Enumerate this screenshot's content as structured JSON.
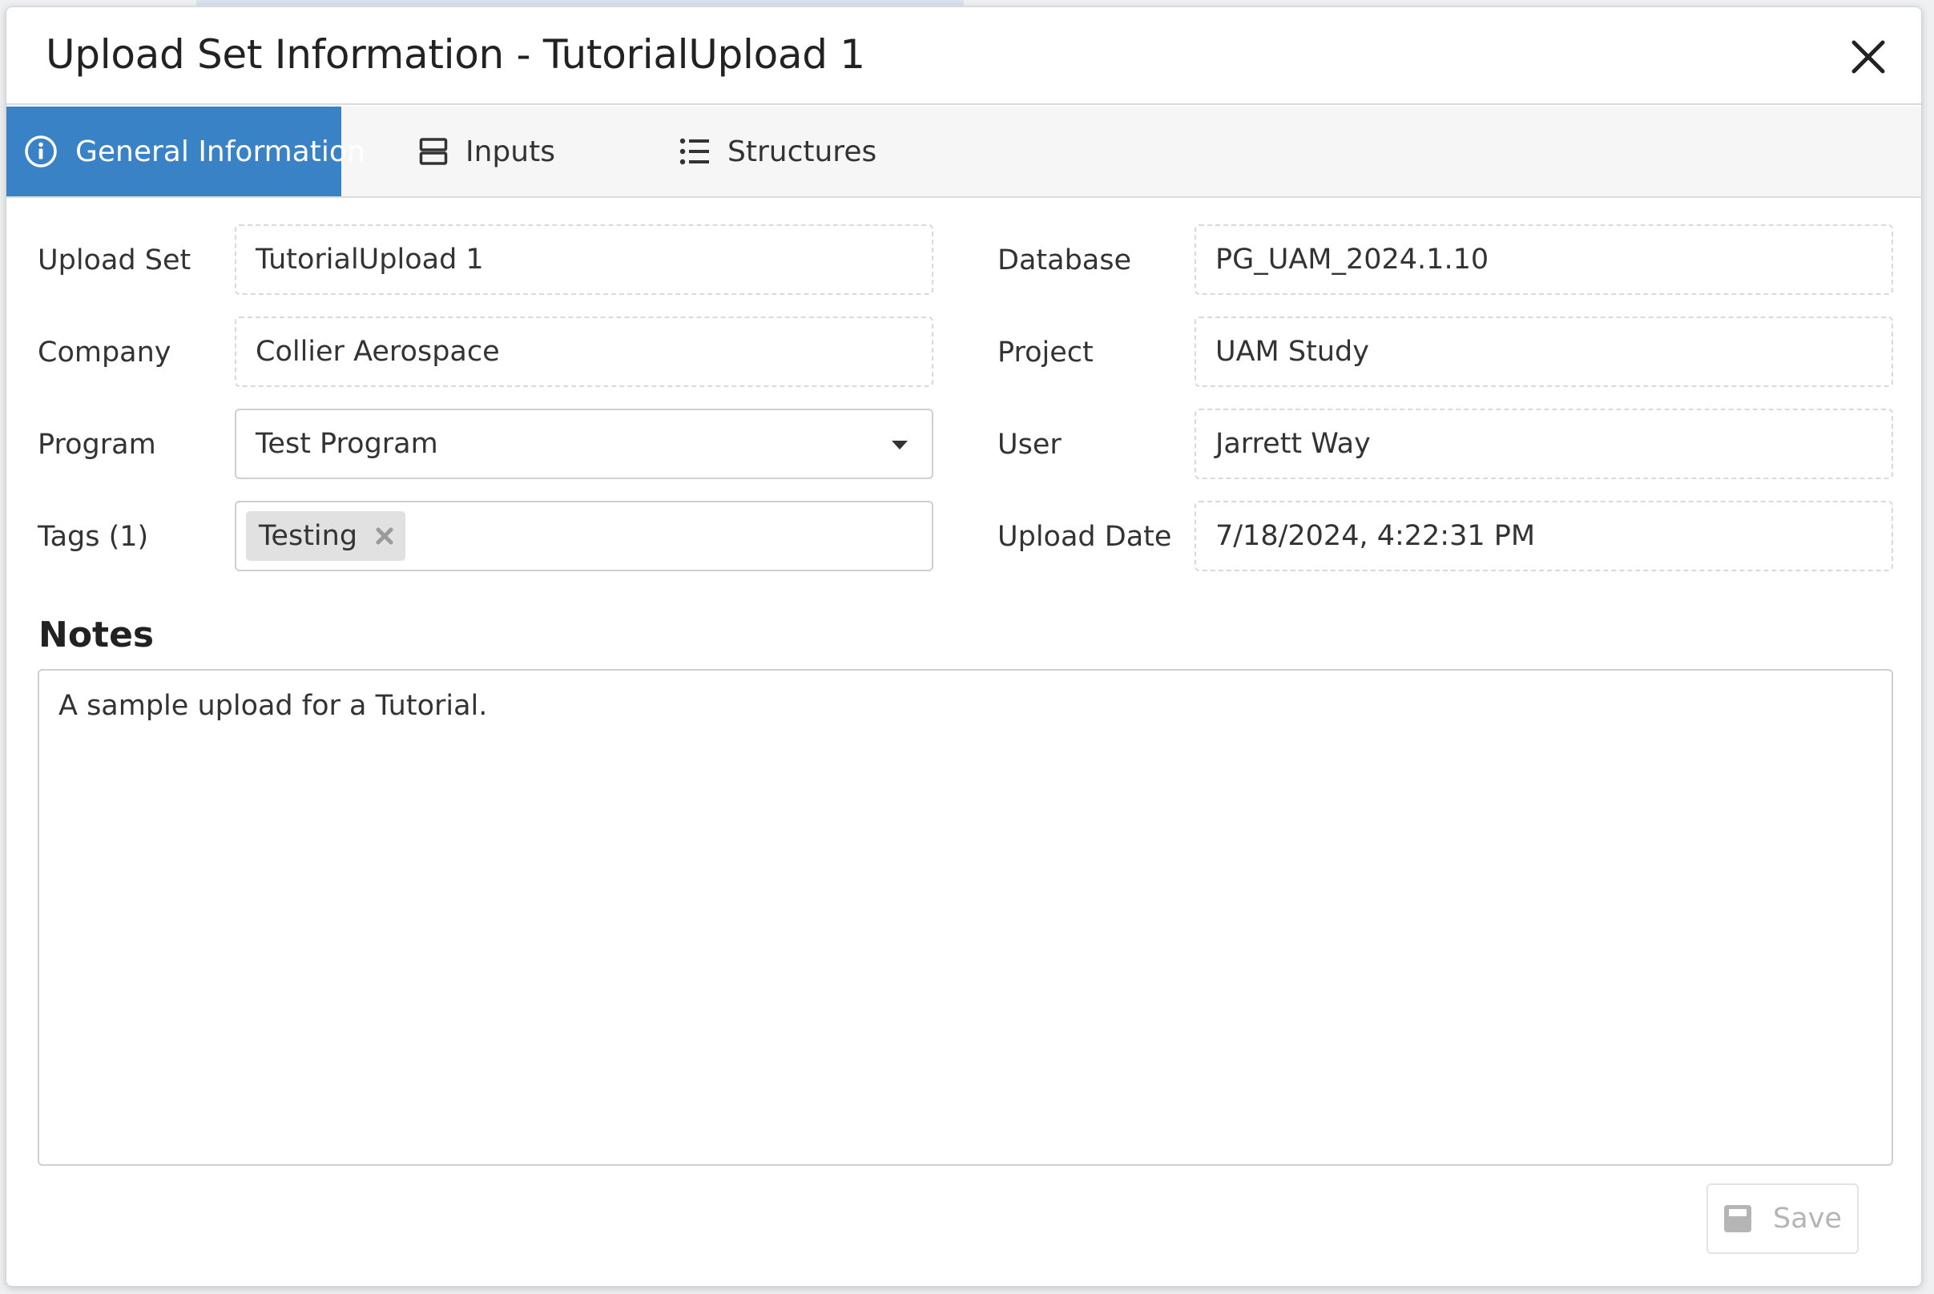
{
  "dialog": {
    "title": "Upload Set Information - TutorialUpload 1",
    "close_icon": "close-icon"
  },
  "tabs": [
    {
      "label": "General Information",
      "icon": "info-circle-icon",
      "active": true
    },
    {
      "label": "Inputs",
      "icon": "server-icon",
      "active": false
    },
    {
      "label": "Structures",
      "icon": "list-icon",
      "active": false
    }
  ],
  "form": {
    "upload_set": {
      "label": "Upload Set",
      "value": "TutorialUpload 1"
    },
    "company": {
      "label": "Company",
      "value": "Collier Aerospace"
    },
    "program": {
      "label": "Program",
      "value": "Test Program"
    },
    "tags": {
      "label": "Tags (1)",
      "items": [
        "Testing"
      ]
    },
    "database": {
      "label": "Database",
      "value": "PG_UAM_2024.1.10"
    },
    "project": {
      "label": "Project",
      "value": "UAM Study"
    },
    "user": {
      "label": "User",
      "value": "Jarrett Way"
    },
    "upload_date": {
      "label": "Upload Date",
      "value": "7/18/2024, 4:22:31 PM"
    }
  },
  "notes": {
    "heading": "Notes",
    "text": "A sample upload for a Tutorial."
  },
  "actions": {
    "save_label": "Save",
    "save_icon": "floppy-disk-icon"
  },
  "colors": {
    "accent": "#3a82c6",
    "tab_bar_bg": "#f6f6f6",
    "tag_bg": "#e1e1e1",
    "disabled_text": "#b5b5b5"
  }
}
